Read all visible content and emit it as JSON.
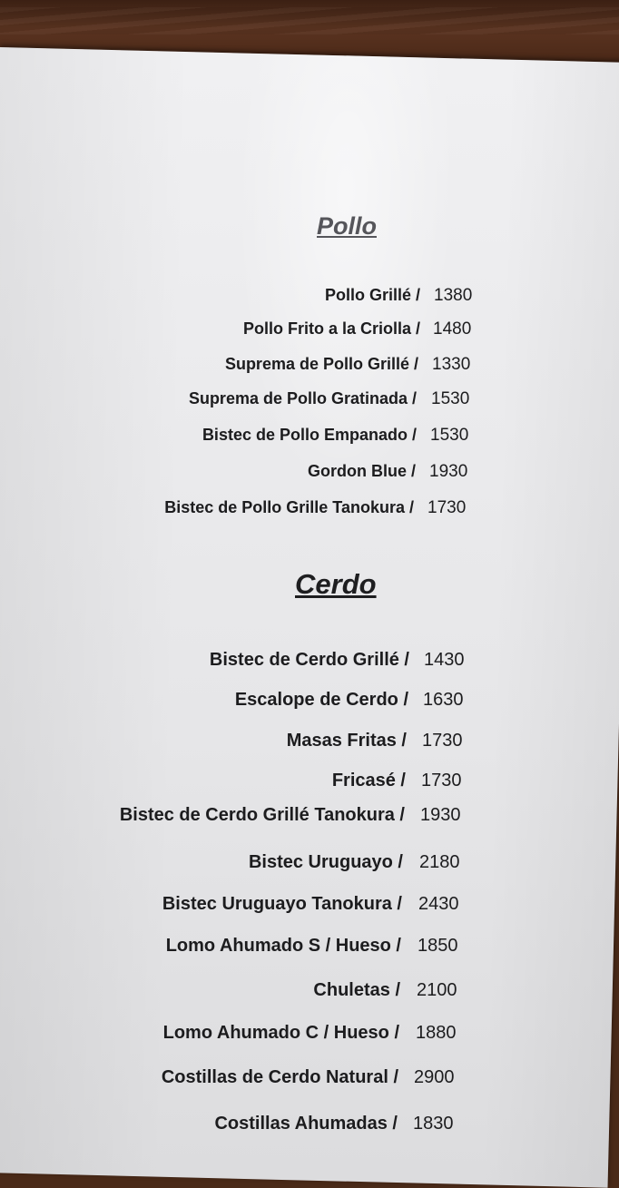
{
  "sections": [
    {
      "title": "Pollo",
      "items": [
        {
          "name": "Pollo Grillé /",
          "price": "1380"
        },
        {
          "name": "Pollo Frito a la Criolla  /",
          "price": "1480"
        },
        {
          "name": "Suprema de Pollo Grillé /",
          "price": "1330"
        },
        {
          "name": "Suprema de Pollo Gratinada  /",
          "price": "1530"
        },
        {
          "name": "Bistec de Pollo Empanado  /",
          "price": "1530"
        },
        {
          "name": "Gordon Blue  /",
          "price": "1930"
        },
        {
          "name": "Bistec de Pollo Grille Tanokura  /",
          "price": "1730"
        }
      ]
    },
    {
      "title": "Cerdo",
      "items": [
        {
          "name": "Bistec de Cerdo Grillé /",
          "price": "1430"
        },
        {
          "name": "Escalope de Cerdo /",
          "price": "1630"
        },
        {
          "name": "Masas Fritas /",
          "price": "1730"
        },
        {
          "name": "Fricasé /",
          "price": "1730"
        },
        {
          "name": "Bistec de Cerdo Grillé Tanokura /",
          "price": "1930"
        },
        {
          "name": "Bistec Uruguayo /",
          "price": "2180"
        },
        {
          "name": "Bistec Uruguayo Tanokura /",
          "price": "2430"
        },
        {
          "name": "Lomo Ahumado S / Hueso /",
          "price": "1850"
        },
        {
          "name": "Chuletas /",
          "price": "2100"
        },
        {
          "name": "Lomo Ahumado C / Hueso /",
          "price": "1880"
        },
        {
          "name": "Costillas de Cerdo Natural /",
          "price": "2900"
        },
        {
          "name": "Costillas Ahumadas /",
          "price": "1830"
        }
      ]
    }
  ]
}
